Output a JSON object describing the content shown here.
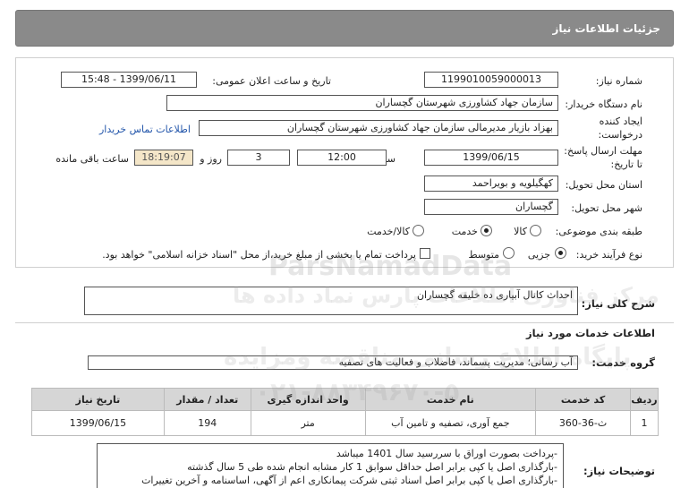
{
  "header": {
    "title": "جزئیات اطلاعات نیاز"
  },
  "form": {
    "need_number_label": "شماره نیاز:",
    "need_number": "1199010059000013",
    "announce_label": "تاریخ و ساعت اعلان عمومی:",
    "announce_value": "1399/06/11 - 15:48",
    "buyer_org_label": "نام دستگاه خریدار:",
    "buyer_org": "سازمان جهاد کشاورزی شهرستان گچساران",
    "creator_label_1": "ایجاد کننده",
    "creator_label_2": "درخواست:",
    "creator": "بهزاد بازیار مدیرمالی سازمان جهاد کشاورزی شهرستان گچساران",
    "contact_link": "اطلاعات تماس خریدار",
    "deadline_label_1": "مهلت ارسال پاسخ:",
    "deadline_label_2": "تا تاریخ:",
    "deadline_date": "1399/06/15",
    "time_label": "ساعت",
    "deadline_time": "12:00",
    "days_value": "3",
    "days_label": "روز و",
    "remaining_time": "18:19:07",
    "remaining_label": "ساعت باقی مانده",
    "province_label": "استان محل تحویل:",
    "province": "کهگیلویه و بویراحمد",
    "city_label": "شهر محل تحویل:",
    "city": "گچساران",
    "category_label": "طبقه بندی موضوعی:",
    "category_options": [
      "کالا",
      "خدمت",
      "کالا/خدمت"
    ],
    "category_selected": "خدمت",
    "process_label": "نوع فرآیند خرید:",
    "process_options": [
      "جزیی",
      "متوسط"
    ],
    "process_selected": "جزیی",
    "payment_note": "پرداخت تمام یا بخشی از مبلغ خرید،از محل \"اسناد خزانه اسلامی\" خواهد بود."
  },
  "summary": {
    "label": "شرح کلی نیاز:",
    "text": "احداث کانال آبیاری ده خلیفه گچساران"
  },
  "services": {
    "section_title": "اطلاعات خدمات مورد نیاز",
    "group_label": "گروه خدمت:",
    "group_value": "آب رسانی؛ مدیریت پسماند، فاضلاب و فعالیت های تصفیه",
    "columns": [
      "ردیف",
      "کد خدمت",
      "نام خدمت",
      "واحد اندازه گیری",
      "تعداد / مقدار",
      "تاریخ نیاز"
    ],
    "rows": [
      [
        "1",
        "ث-36-360",
        "جمع آوری، تصفیه و تامین آب",
        "متر",
        "194",
        "1399/06/15"
      ]
    ]
  },
  "notes": {
    "label": "توضیحات نیاز:",
    "lines": [
      "-پرداخت بصورت اوراق با سررسید سال 1401 میباشد",
      "-بارگذاری اصل یا کپی برابر اصل حداقل سوابق 1 کار مشابه انجام شده طی 5 سال گذشته",
      "-بارگذاری اصل یا کپی برابر اصل اسناد ثبتی شرکت پیمانکاری اعم از آگهی، اساسنامه و آخرین تغییرات"
    ]
  },
  "watermark": {
    "line1": "ParsNamadData",
    "line2": "مرکز فناوری اطلاعات پارس نماد داده ها",
    "line3": "پایگاه اطلاع رسانی مناقصه ومزایده",
    "line4": "۰۲۱-۸۸۳۴۹۶۷۰-۵"
  },
  "colors": {
    "header_bg": "#8a8a8a",
    "timer_bg": "#f4e6c8",
    "link": "#2255aa",
    "table_header_bg": "#d6d6d6"
  }
}
